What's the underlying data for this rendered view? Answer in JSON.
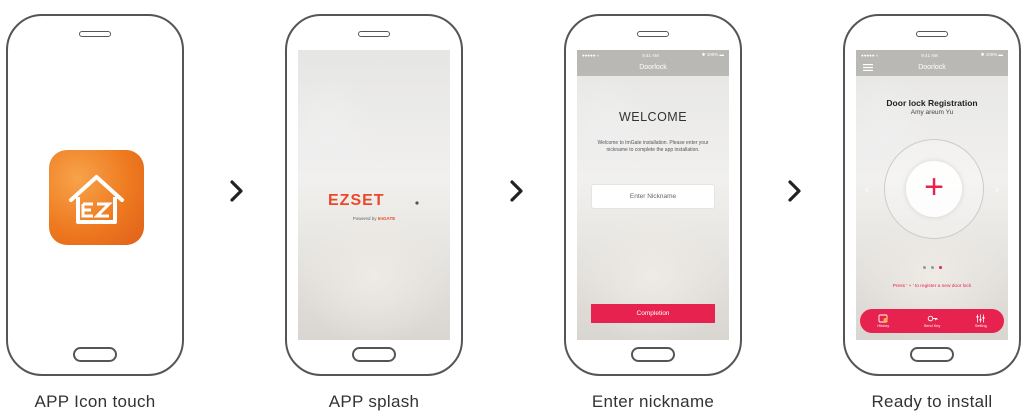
{
  "captions": [
    "APP Icon touch",
    "APP splash",
    "Enter nickname",
    "Ready to install"
  ],
  "arrow_glyph": "›",
  "colors": {
    "accent": "#e8224e",
    "icon_orange": "#ee7a20",
    "outline": "#555555"
  },
  "screen2": {
    "logo": "EZSET",
    "powered_prefix": "Powered by",
    "powered_brand": "ImGATE"
  },
  "screen3": {
    "status": {
      "left": "●●●●● ≈",
      "time": "9:41 AM",
      "right": "✱ 100% ▬"
    },
    "nav_title": "Doorlock",
    "title": "WELCOME",
    "description": "Welcome to ImGate installation. Please enter your nickname to complete the app installation.",
    "input_placeholder": "Enter Nickname",
    "button_label": "Completion"
  },
  "screen4": {
    "status": {
      "left": "●●●●● ≈",
      "time": "9:41 AM",
      "right": "✱ 100% ▬"
    },
    "nav_title": "Doorlock",
    "title": "Door lock Registration",
    "user": "Amy areum Yu",
    "hint": "Press ' + ' to register a new door lock",
    "page_count": 3,
    "active_page": 3,
    "tabs": [
      {
        "label": "History",
        "icon": "history-icon"
      },
      {
        "label": "Send Key",
        "icon": "key-icon"
      },
      {
        "label": "Setting",
        "icon": "sliders-icon"
      }
    ]
  }
}
